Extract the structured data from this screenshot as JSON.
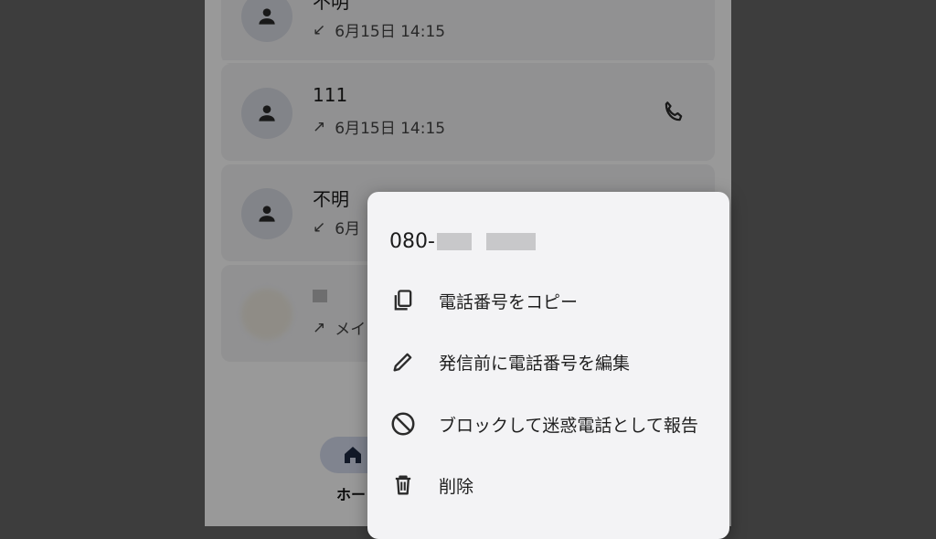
{
  "call_log": [
    {
      "name": "不明",
      "direction": "incoming",
      "arrow": "↙",
      "time": "6月15日 14:15",
      "has_call_button": false
    },
    {
      "name": "111",
      "direction": "outgoing",
      "arrow": "↗",
      "time": "6月15日 14:15",
      "has_call_button": true
    },
    {
      "name": "不明",
      "direction": "incoming",
      "arrow": "↙",
      "time": "6月",
      "has_call_button": false
    },
    {
      "name": "",
      "direction": "outgoing",
      "arrow": "↗",
      "time": "メイ",
      "has_call_button": false
    }
  ],
  "bottom_nav": {
    "home_label": "ホー",
    "home_icon": "home-icon"
  },
  "context_menu": {
    "number_prefix": "080-",
    "items": [
      {
        "label": "電話番号をコピー",
        "icon": "copy-icon"
      },
      {
        "label": "発信前に電話番号を編集",
        "icon": "pencil-icon"
      },
      {
        "label": "ブロックして迷惑電話として報告",
        "icon": "block-icon"
      },
      {
        "label": "削除",
        "icon": "trash-icon"
      }
    ]
  },
  "colors": {
    "scrim": "#000000",
    "menu_bg": "#f3f3f5",
    "avatar_bg": "#d9dce4",
    "nav_pill": "#d6dcef"
  }
}
